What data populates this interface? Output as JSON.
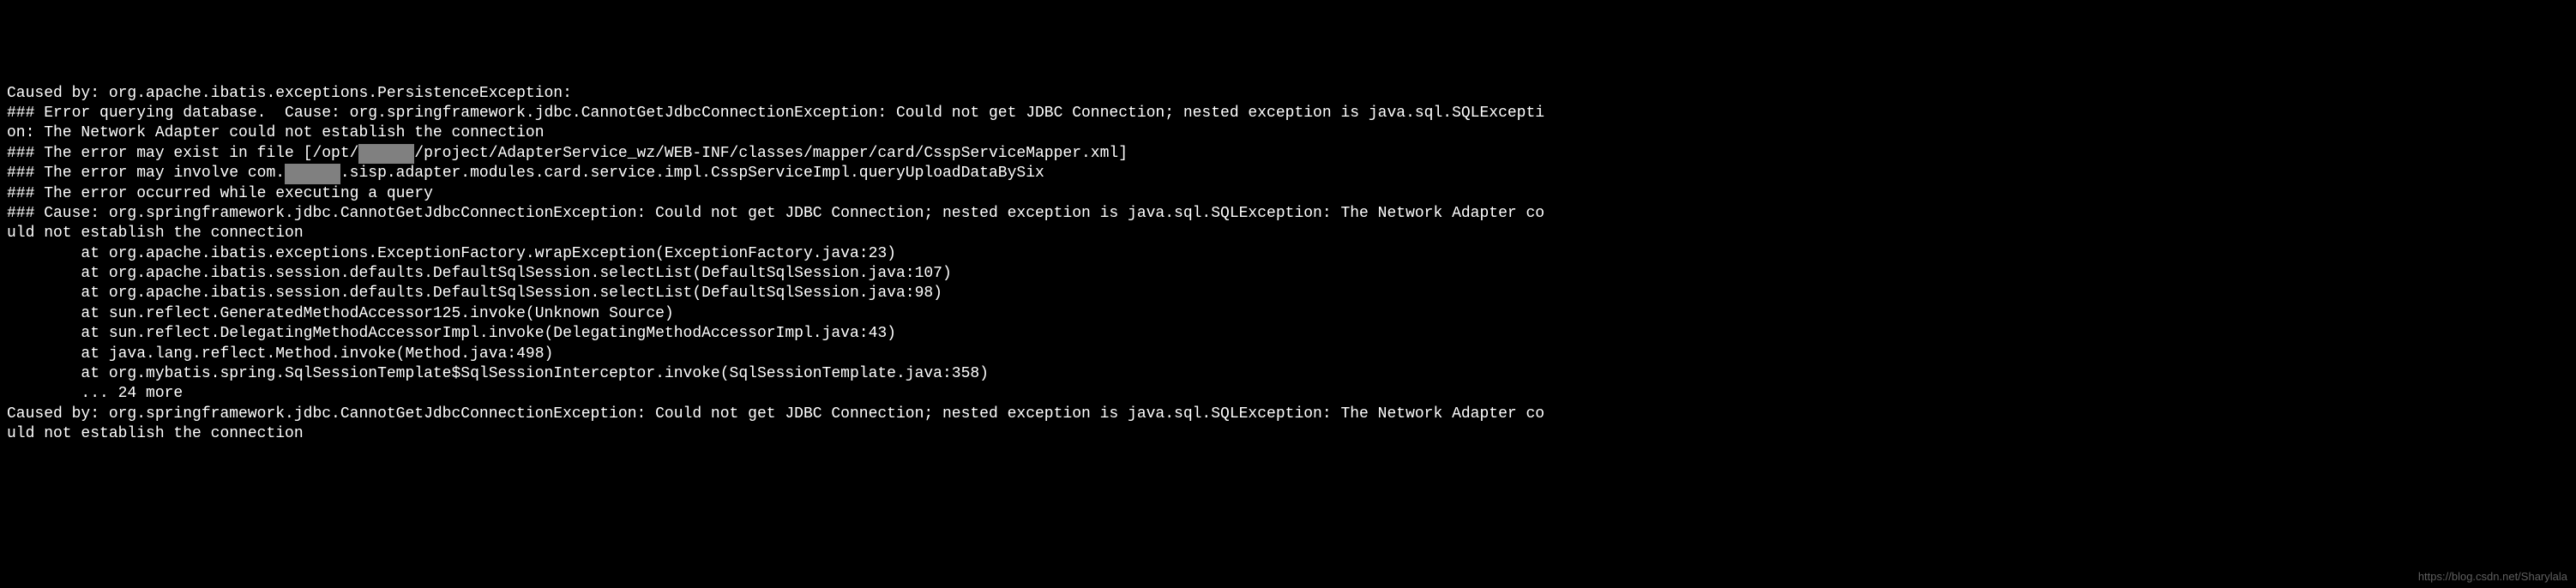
{
  "log": {
    "lines": [
      {
        "prefix": "Caused by: org.apache.ibatis.exceptions.PersistenceException:",
        "redacted": "",
        "suffix": ""
      },
      {
        "prefix": "### Error querying database.  Cause: org.springframework.jdbc.CannotGetJdbcConnectionException: Could not get JDBC Connection; nested exception is java.sql.SQLExcepti",
        "redacted": "",
        "suffix": ""
      },
      {
        "prefix": "on: The Network Adapter could not establish the connection",
        "redacted": "",
        "suffix": ""
      },
      {
        "prefix": "### The error may exist in file [/opt/",
        "redacted": "xxxxxx",
        "suffix": "/project/AdapterService_wz/WEB-INF/classes/mapper/card/CsspServiceMapper.xml]"
      },
      {
        "prefix": "### The error may involve com.",
        "redacted": "xxxxxx",
        "suffix": ".sisp.adapter.modules.card.service.impl.CsspServiceImpl.queryUploadDataBySix"
      },
      {
        "prefix": "### The error occurred while executing a query",
        "redacted": "",
        "suffix": ""
      },
      {
        "prefix": "### Cause: org.springframework.jdbc.CannotGetJdbcConnectionException: Could not get JDBC Connection; nested exception is java.sql.SQLException: The Network Adapter co",
        "redacted": "",
        "suffix": ""
      },
      {
        "prefix": "uld not establish the connection",
        "redacted": "",
        "suffix": ""
      },
      {
        "prefix": "        at org.apache.ibatis.exceptions.ExceptionFactory.wrapException(ExceptionFactory.java:23)",
        "redacted": "",
        "suffix": ""
      },
      {
        "prefix": "        at org.apache.ibatis.session.defaults.DefaultSqlSession.selectList(DefaultSqlSession.java:107)",
        "redacted": "",
        "suffix": ""
      },
      {
        "prefix": "        at org.apache.ibatis.session.defaults.DefaultSqlSession.selectList(DefaultSqlSession.java:98)",
        "redacted": "",
        "suffix": ""
      },
      {
        "prefix": "        at sun.reflect.GeneratedMethodAccessor125.invoke(Unknown Source)",
        "redacted": "",
        "suffix": ""
      },
      {
        "prefix": "        at sun.reflect.DelegatingMethodAccessorImpl.invoke(DelegatingMethodAccessorImpl.java:43)",
        "redacted": "",
        "suffix": ""
      },
      {
        "prefix": "        at java.lang.reflect.Method.invoke(Method.java:498)",
        "redacted": "",
        "suffix": ""
      },
      {
        "prefix": "        at org.mybatis.spring.SqlSessionTemplate$SqlSessionInterceptor.invoke(SqlSessionTemplate.java:358)",
        "redacted": "",
        "suffix": ""
      },
      {
        "prefix": "        ... 24 more",
        "redacted": "",
        "suffix": ""
      },
      {
        "prefix": "Caused by: org.springframework.jdbc.CannotGetJdbcConnectionException: Could not get JDBC Connection; nested exception is java.sql.SQLException: The Network Adapter co",
        "redacted": "",
        "suffix": ""
      },
      {
        "prefix": "uld not establish the connection",
        "redacted": "",
        "suffix": ""
      }
    ]
  },
  "watermark": "https://blog.csdn.net/Sharylala"
}
